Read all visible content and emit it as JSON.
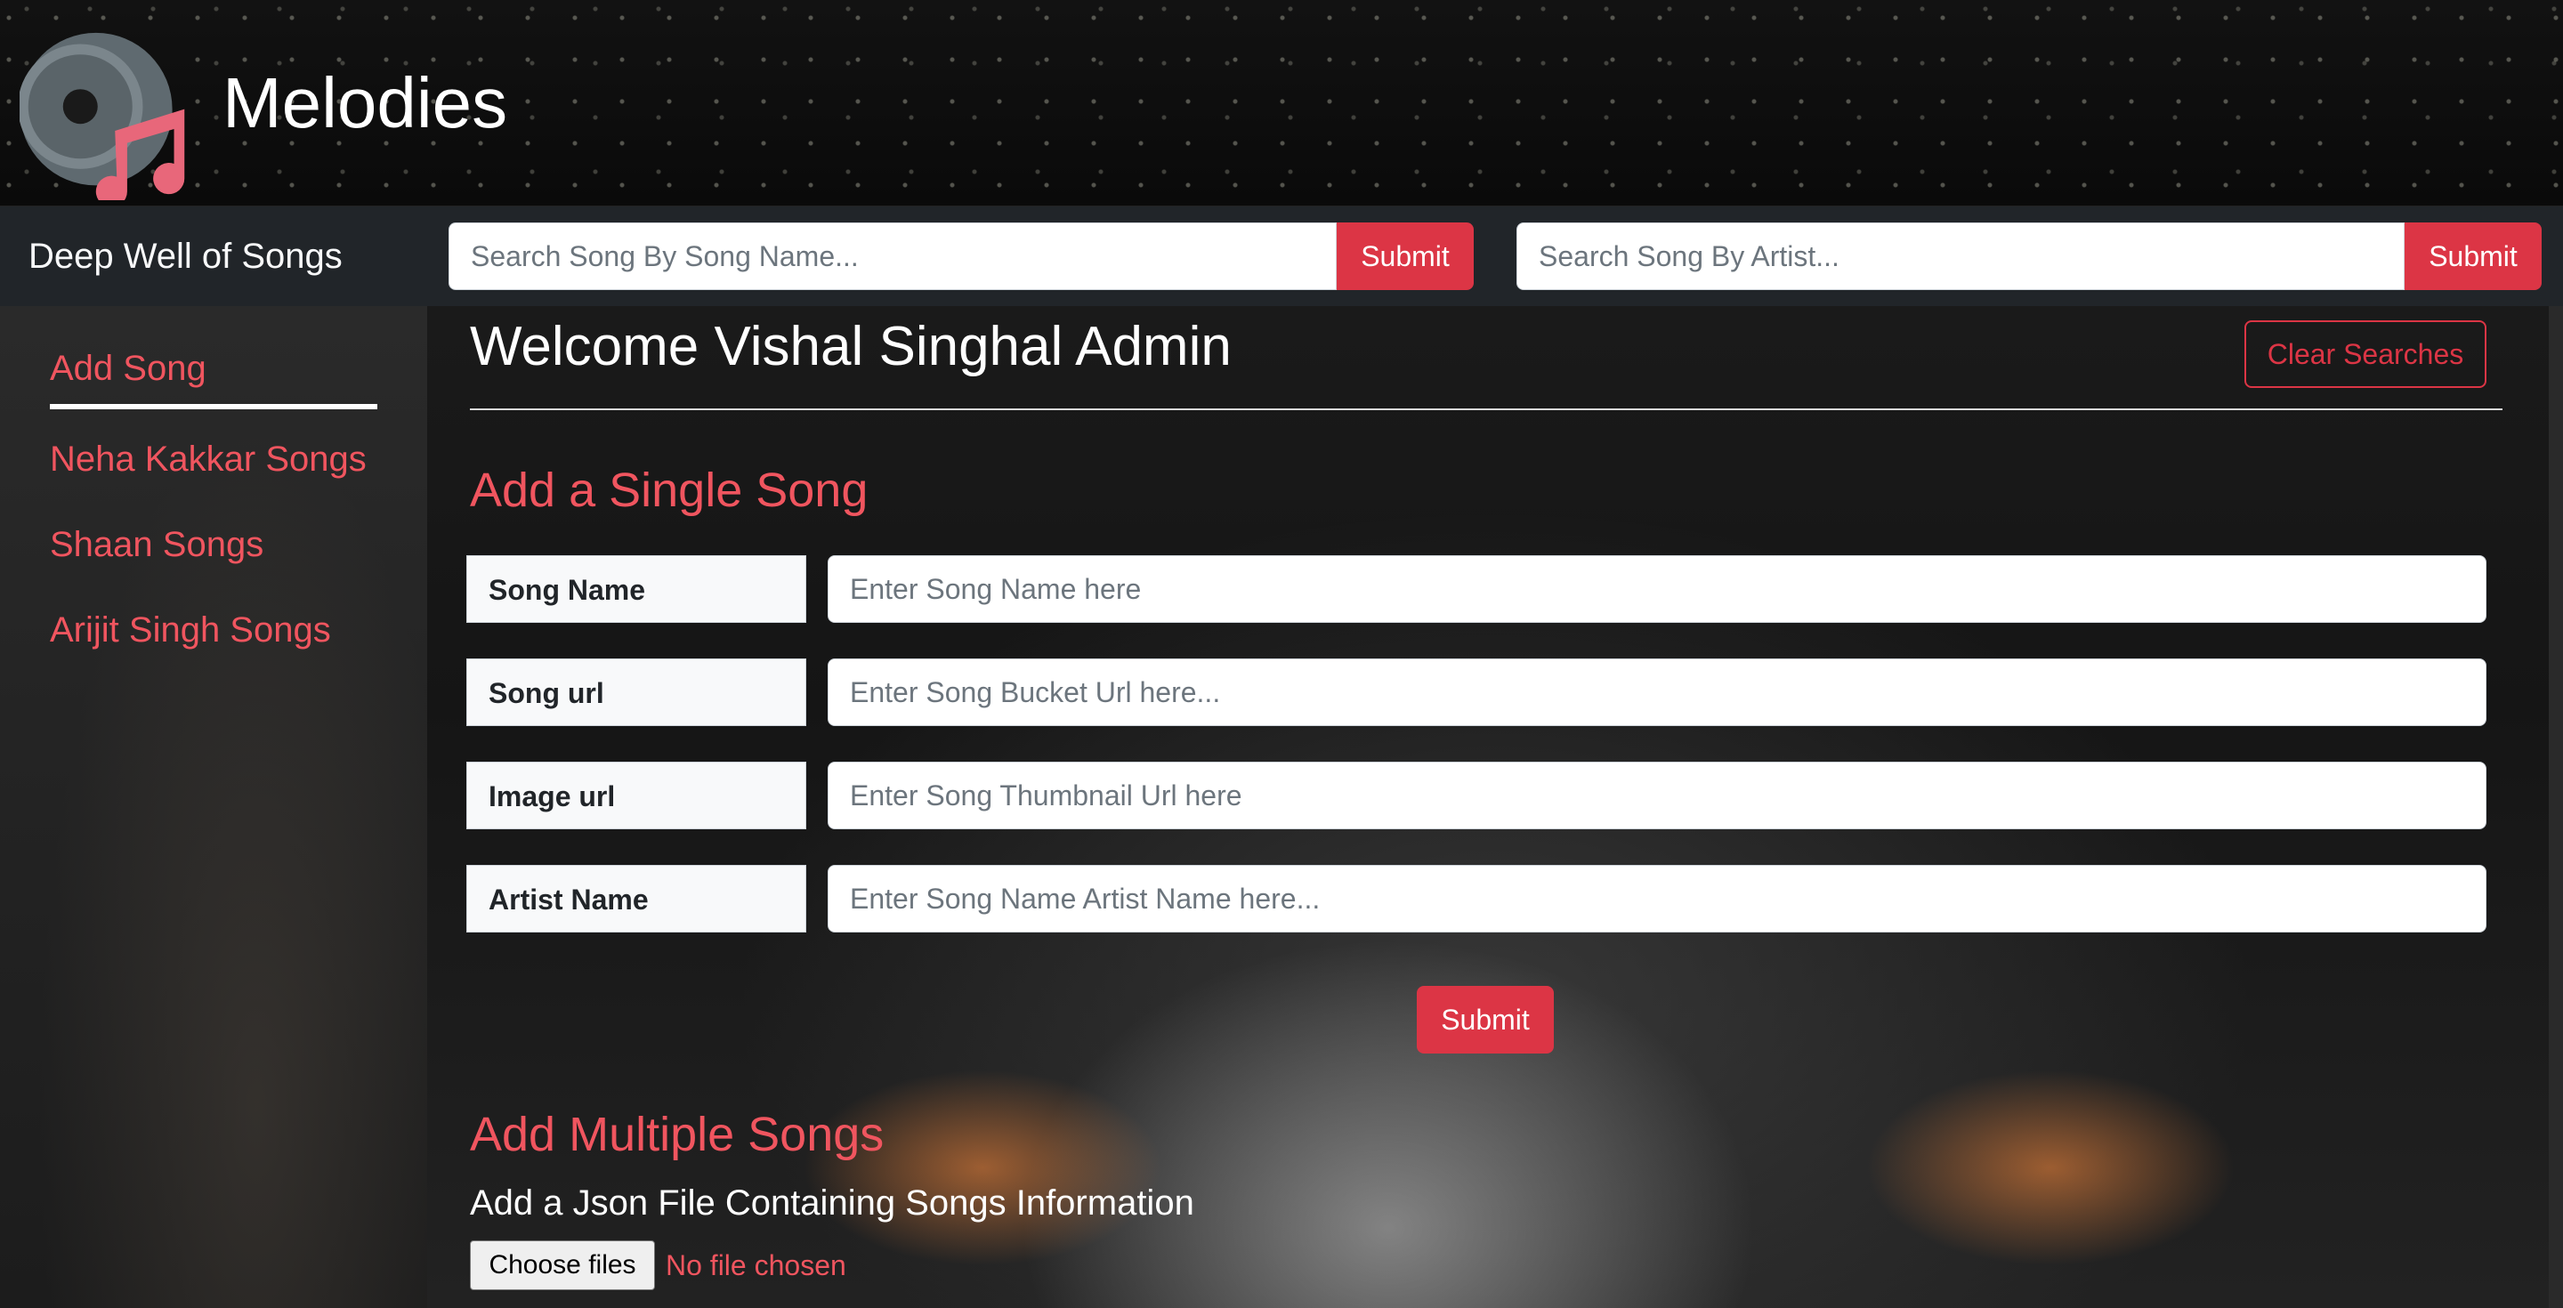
{
  "header": {
    "app_title": "Melodies",
    "logo_icon": "music-disc-logo"
  },
  "navbar": {
    "brand": "Deep Well of Songs",
    "song_search": {
      "placeholder": "Search Song By Song Name...",
      "submit_label": "Submit"
    },
    "artist_search": {
      "placeholder": "Search Song By Artist...",
      "submit_label": "Submit"
    }
  },
  "sidebar": {
    "items": [
      {
        "label": "Add Song",
        "active": true
      },
      {
        "label": "Neha Kakkar Songs"
      },
      {
        "label": "Shaan Songs"
      },
      {
        "label": "Arijit Singh Songs"
      }
    ]
  },
  "main": {
    "welcome": "Welcome Vishal Singhal Admin",
    "clear_label": "Clear Searches",
    "single_title": "Add a Single Song",
    "fields": [
      {
        "label": "Song Name",
        "placeholder": "Enter Song Name here"
      },
      {
        "label": "Song url",
        "placeholder": "Enter Song Bucket Url here..."
      },
      {
        "label": "Image url",
        "placeholder": "Enter Song Thumbnail Url here"
      },
      {
        "label": "Artist Name",
        "placeholder": "Enter Song Name Artist Name here..."
      }
    ],
    "submit_label": "Submit",
    "multi_title": "Add Multiple Songs",
    "json_label": "Add a Json File Containing Songs Information",
    "file_button": "Choose files",
    "file_status": "No file chosen"
  },
  "colors": {
    "accent": "#dc3545",
    "link": "#f0555f",
    "navbar": "#212529"
  }
}
